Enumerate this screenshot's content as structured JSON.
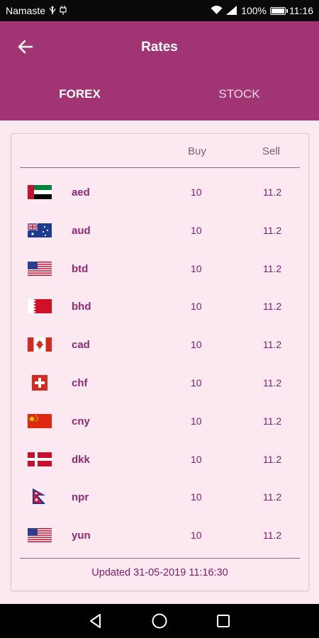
{
  "status_bar": {
    "carrier": "Namaste",
    "battery": "100%",
    "time": "11:16",
    "icons": [
      "usb-icon",
      "charging-icon",
      "wifi-icon",
      "signal-icon",
      "battery-icon"
    ]
  },
  "app_bar": {
    "title": "Rates",
    "back_icon": "back-arrow-icon",
    "background": "#a13574"
  },
  "tabs": [
    {
      "label": "FOREX",
      "active": true
    },
    {
      "label": "STOCK",
      "active": false
    }
  ],
  "table": {
    "columns": {
      "buy": "Buy",
      "sell": "Sell"
    },
    "rows": [
      {
        "code": "aed",
        "flag": "uae-flag-icon",
        "buy": "10",
        "sell": "11.2"
      },
      {
        "code": "aud",
        "flag": "australia-flag-icon",
        "buy": "10",
        "sell": "11.2"
      },
      {
        "code": "btd",
        "flag": "usa-flag-icon",
        "buy": "10",
        "sell": "11.2"
      },
      {
        "code": "bhd",
        "flag": "bahrain-flag-icon",
        "buy": "10",
        "sell": "11.2"
      },
      {
        "code": "cad",
        "flag": "canada-flag-icon",
        "buy": "10",
        "sell": "11.2"
      },
      {
        "code": "chf",
        "flag": "switzerland-flag-icon",
        "buy": "10",
        "sell": "11.2"
      },
      {
        "code": "cny",
        "flag": "china-flag-icon",
        "buy": "10",
        "sell": "11.2"
      },
      {
        "code": "dkk",
        "flag": "denmark-flag-icon",
        "buy": "10",
        "sell": "11.2"
      },
      {
        "code": "npr",
        "flag": "nepal-flag-icon",
        "buy": "10",
        "sell": "11.2"
      },
      {
        "code": "yun",
        "flag": "usa-flag-icon",
        "buy": "10",
        "sell": "11.2"
      }
    ],
    "updated": "Updated 31-05-2019 11:16:30"
  },
  "nav_bar": {
    "buttons": [
      "back-triangle-icon",
      "home-circle-icon",
      "recents-square-icon"
    ]
  }
}
